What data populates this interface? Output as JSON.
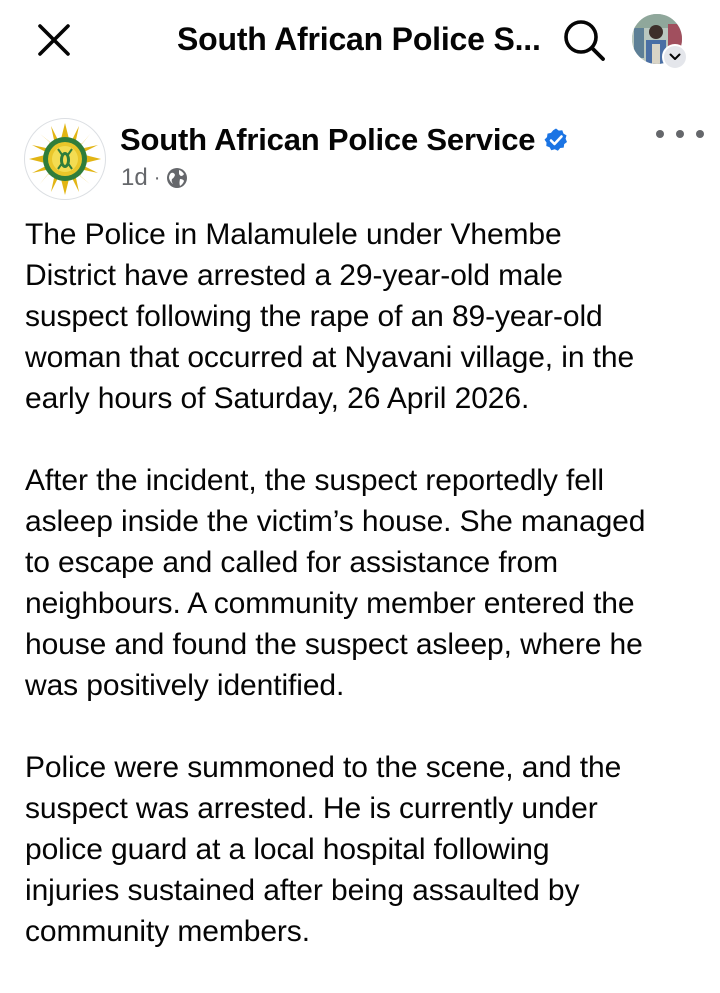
{
  "topbar": {
    "close_icon": "close-icon",
    "title": "South African Police S...",
    "search_icon": "search-icon",
    "profile_icon": "profile-avatar",
    "chevron_icon": "chevron-down-icon"
  },
  "post": {
    "page_name": "South African Police Service",
    "verified": true,
    "verified_color": "#1b74e4",
    "time": "1d",
    "separator": "·",
    "audience_icon": "globe-icon",
    "more_icon": "more-dots-icon",
    "paragraphs": [
      "The Police in Malamulele under Vhembe\nDistrict have arrested a 29-year-old male\nsuspect following the rape of an 89-year-old\nwoman that occurred at Nyavani village, in the\nearly hours of Saturday, 26 April 2026.",
      "After the incident, the suspect reportedly fell\nasleep inside the victim’s house. She managed\nto escape and called for assistance from\nneighbours. A community member entered the\nhouse and found the suspect asleep, where he\nwas positively identified.",
      "Police were summoned to the scene, and the\nsuspect was arrested. He is currently under\npolice guard at a local hospital following\ninjuries sustained after being assaulted by\ncommunity members."
    ]
  },
  "colors": {
    "text_primary": "#050505",
    "text_secondary": "#65676b",
    "background": "#ffffff",
    "badge_blue": "#1b74e4",
    "logo_gold": "#e2b514",
    "logo_green": "#2f7d3b"
  }
}
